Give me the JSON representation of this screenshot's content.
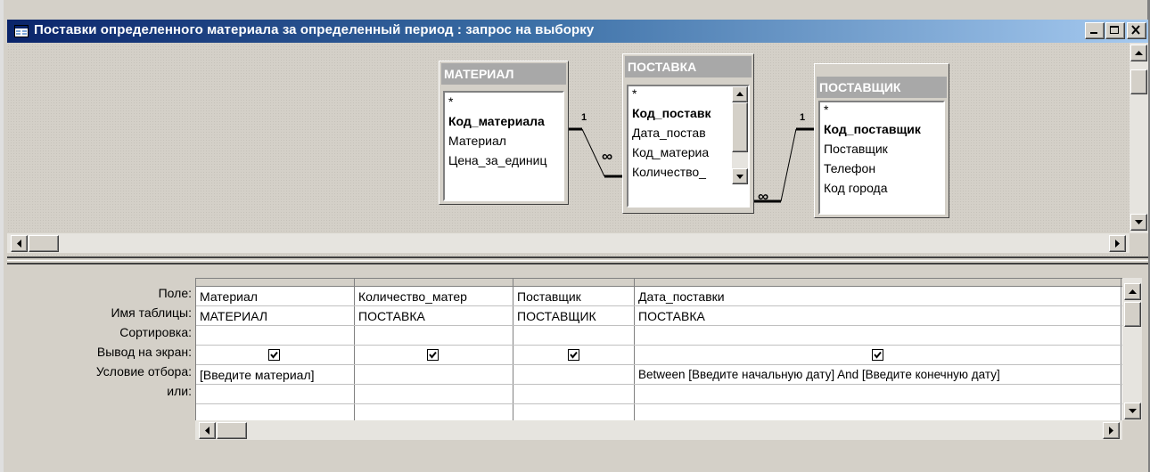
{
  "window": {
    "title": "Поставки определенного материала за определенный период : запрос на выборку"
  },
  "tables": [
    {
      "name": "МАТЕРИАЛ",
      "fields": [
        "*",
        "Код_материала",
        "Материал",
        "Цена_за_единиц"
      ],
      "key_field": "Код_материала"
    },
    {
      "name": "ПОСТАВКА",
      "fields": [
        "*",
        "Код_поставк",
        "Дата_постав",
        "Код_материа",
        "Количество_"
      ],
      "key_field": "Код_поставк"
    },
    {
      "name": "ПОСТАВЩИК",
      "fields": [
        "*",
        "Код_поставщик",
        "Поставщик",
        "Телефон",
        "Код города"
      ],
      "key_field": "Код_поставщик"
    }
  ],
  "relations": [
    {
      "one": "1",
      "many": "∞"
    },
    {
      "one": "1",
      "many": "∞"
    }
  ],
  "grid": {
    "row_labels": [
      "Поле:",
      "Имя таблицы:",
      "Сортировка:",
      "Вывод на экран:",
      "Условие отбора:",
      "или:"
    ],
    "columns": [
      {
        "field": "Материал",
        "table": "МАТЕРИАЛ",
        "sort": "",
        "show": true,
        "criteria": "[Введите материал]",
        "or": ""
      },
      {
        "field": "Количество_матер",
        "table": "ПОСТАВКА",
        "sort": "",
        "show": true,
        "criteria": "",
        "or": ""
      },
      {
        "field": "Поставщик",
        "table": "ПОСТАВЩИК",
        "sort": "",
        "show": true,
        "criteria": "",
        "or": ""
      },
      {
        "field": "Дата_поставки",
        "table": "ПОСТАВКА",
        "sort": "",
        "show": true,
        "criteria": "Between [Введите начальную дату] And [Введите конечную дату]",
        "or": ""
      }
    ]
  },
  "icons": {
    "title": "query-icon",
    "minimize": "minimize-icon",
    "maximize": "maximize-icon",
    "close": "close-icon"
  }
}
